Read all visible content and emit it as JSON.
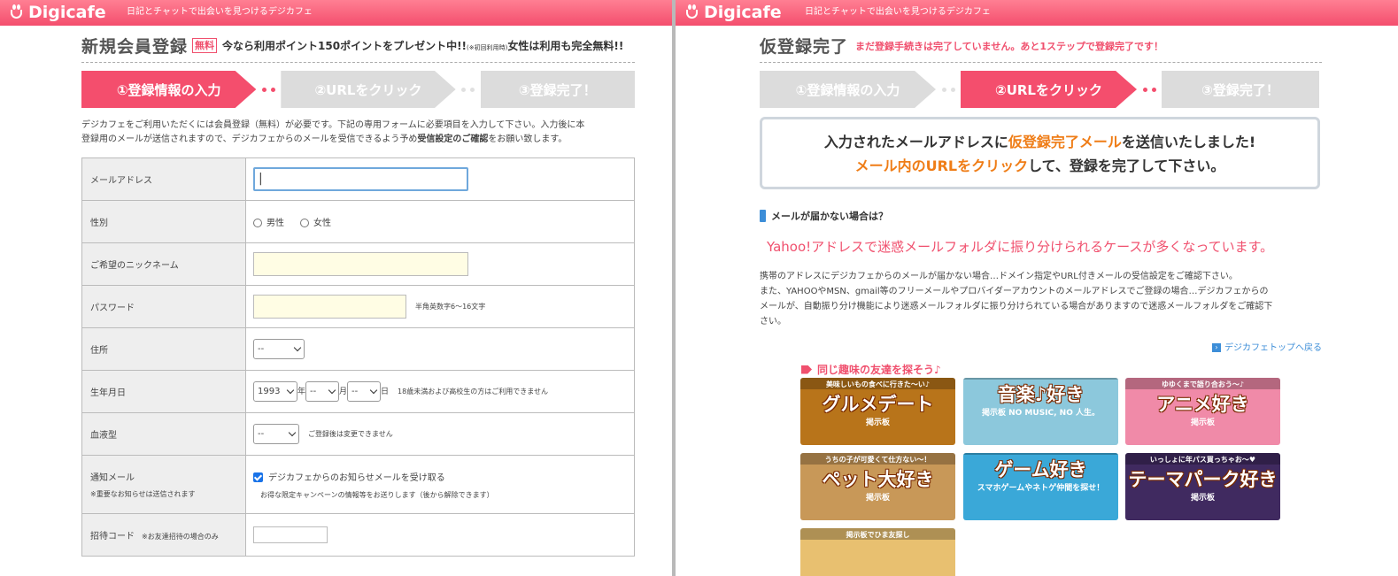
{
  "left": {
    "brand": "Digicafe",
    "tagline": "日記とチャットで出会いを見つけるデジカフェ",
    "title": "新規会員登録",
    "free_badge": "無料",
    "promo_a": "今なら利用ポイント150ポイントをプレゼント中!!",
    "promo_small": "(※初回利用時)",
    "promo_b": "女性は利用も完全無料!!",
    "steps": [
      "①登録情報の入力",
      "②URLをクリック",
      "③登録完了！"
    ],
    "intro_1": "デジカフェをご利用いただくには会員登録（無料）が必要です。下記の専用フォームに必要項目を入力して下さい。入力後に本",
    "intro_2a": "登録用のメールが送信されますので、デジカフェからのメールを受信できるよう予め",
    "intro_2b": "受信設定のご確認",
    "intro_2c": "をお願い致します。",
    "form": {
      "email_label": "メールアドレス",
      "gender_label": "性別",
      "male": "男性",
      "female": "女性",
      "nickname_label": "ご希望のニックネーム",
      "password_label": "パスワード",
      "password_note": "半角英数字6〜16文字",
      "address_label": "住所",
      "address_value": "--",
      "birth_label": "生年月日",
      "birth_year": "1993",
      "year_unit": "年",
      "birth_month": "--",
      "month_unit": "月",
      "birth_day": "--",
      "day_unit": "日",
      "birth_note": "18歳未満および高校生の方はご利用できません",
      "blood_label": "血液型",
      "blood_value": "--",
      "blood_note": "ご登録後は変更できません",
      "notice_label": "通知メール",
      "notice_sub": "※重要なお知らせは送信されます",
      "notice_check": "デジカフェからのお知らせメールを受け取る",
      "notice_note": "お得な限定キャンペーンの情報等をお送りします（後から解除できます）",
      "invite_label": "招待コード",
      "invite_sub": "※お友達招待の場合のみ"
    }
  },
  "right": {
    "brand": "Digicafe",
    "tagline": "日記とチャットで出会いを見つけるデジカフェ",
    "title": "仮登録完了",
    "subtitle": "まだ登録手続きは完了していません。あと1ステップで登録完了です！",
    "steps": [
      "①登録情報の入力",
      "②URLをクリック",
      "③登録完了！"
    ],
    "msg_1a": "入力されたメールアドレスに",
    "msg_1b": "仮登録完了メール",
    "msg_1c": "を送信いたしました!",
    "msg_2a": "メール内のURLをクリック",
    "msg_2b": "して、登録を完了して下さい。",
    "no_mail_heading": "メールが届かない場合は？",
    "yahoo_notice": "Yahoo!アドレスで迷惑メールフォルダに振り分けられるケースが多くなっています。",
    "para_1": "携帯のアドレスにデジカフェからのメールが届かない場合…ドメイン指定やURL付きメールの受信設定をご確認下さい。",
    "para_2": "また、YAHOOやMSN、gmail等のフリーメールやプロバイダーアカウントのメールアドレスでご登録の場合…デジカフェからの",
    "para_3": "メールが、自動振り分け機能により迷惑メールフォルダに振り分けられている場合がありますので迷惑メールフォルダをご確認下",
    "para_4": "さい。",
    "top_link": "デジカフェトップへ戻る",
    "same_hobby": "同じ趣味の友達を探そう♪",
    "banners": [
      {
        "top": "美味しいもの食べに行きた〜い♪",
        "main": "グルメデート",
        "sub": "掲示板",
        "color": "#b8741a"
      },
      {
        "top": "",
        "main": "音楽♪好き",
        "sub": "掲示板 NO MUSIC, NO 人生。",
        "color": "#8cc8dc"
      },
      {
        "top": "ゆゆくまで語り合おう〜♪",
        "main": "アニメ好き",
        "sub": "掲示板",
        "color": "#f08aa8"
      },
      {
        "top": "うちの子が可愛くて仕方ない〜！",
        "main": "ペット大好き",
        "sub": "掲示板",
        "color": "#c89858"
      },
      {
        "top": "",
        "main": "ゲーム好き",
        "sub": "スマホゲームやネトゲ仲間を探せ！",
        "color": "#3aa8d8"
      },
      {
        "top": "いっしょに年パス買っちゃお〜♥",
        "main": "テーマパーク好き",
        "sub": "掲示板",
        "color": "#402a60"
      },
      {
        "top": "掲示板でひま友探し",
        "main": "",
        "sub": "",
        "color": "#e8c070"
      }
    ]
  }
}
